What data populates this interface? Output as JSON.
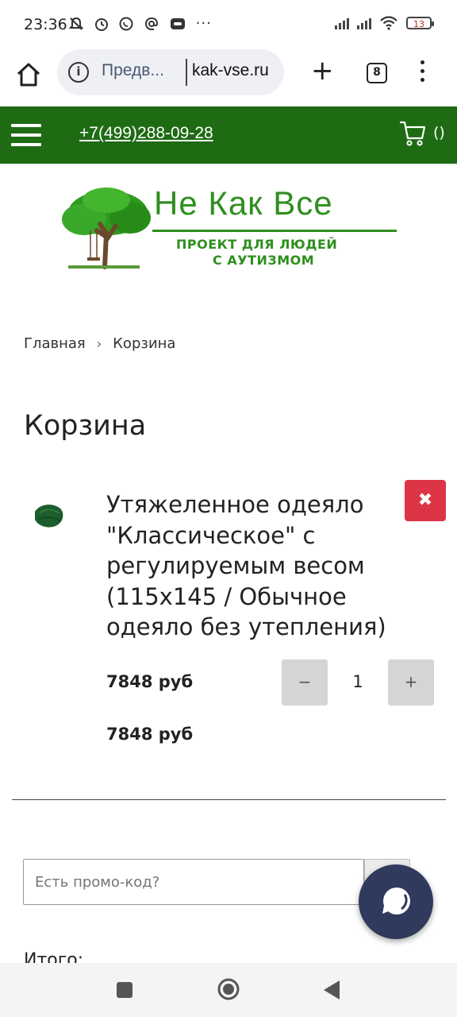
{
  "status_bar": {
    "time": "23:36",
    "left_icons": [
      "muted-notification-icon",
      "alarm-icon",
      "whatsapp-icon",
      "email-at-icon",
      "app-icon",
      "more-dots-icon"
    ],
    "battery_level": "13",
    "overflow": "···"
  },
  "browser": {
    "url_prefix": "Предв...",
    "url_domain": "kak-vse.ru",
    "tab_count": "8"
  },
  "header": {
    "phone": "+7(499)288-09-28",
    "cart_count": "()",
    "colors": {
      "bar": "#1e6b14",
      "text": "#ffffff"
    }
  },
  "logo": {
    "title": "Не Как Все",
    "subtitle_line1": "ПРОЕКТ ДЛЯ ЛЮДЕЙ",
    "subtitle_line2": "С АУТИЗМОМ",
    "color": "#2e8f1e"
  },
  "breadcrumb": {
    "home": "Главная",
    "separator": "›",
    "current": "Корзина"
  },
  "page_title": "Корзина",
  "cart": {
    "items": [
      {
        "name": "Утяжеленное одеяло \"Классическое\" с регулируемым весом (115x145 / Обычное одеяло без утепления)",
        "price": "7848 руб",
        "quantity": "1",
        "total": "7848 руб",
        "remove_label": "✖",
        "minus_label": "−",
        "plus_label": "+"
      }
    ],
    "promo_placeholder": "Есть промо-код?",
    "total_label": "Итого:"
  }
}
